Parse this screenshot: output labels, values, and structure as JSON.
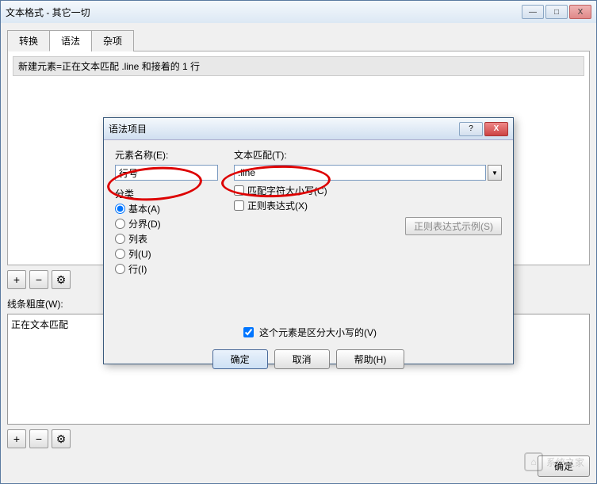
{
  "window": {
    "title": "文本格式 - 其它一切",
    "minimize": "—",
    "maximize": "□",
    "close": "X"
  },
  "tabs": {
    "convert": "转换",
    "syntax": "语法",
    "misc": "杂项"
  },
  "info_text": "新建元素=正在文本匹配 .line 和接着的 1 行",
  "toolbar": {
    "plus": "+",
    "minus": "−",
    "gear": "⚙"
  },
  "thickness_label": "线条粗度(W):",
  "listbox_item": "正在文本匹配",
  "main_buttons": {
    "ok": "确定"
  },
  "dialog": {
    "title": "语法项目",
    "help_q": "?",
    "close": "X",
    "element_name_label": "元素名称(E):",
    "element_name_value": "行号",
    "text_match_label": "文本匹配(T):",
    "text_match_value": ".line",
    "category_label": "分类",
    "radios": {
      "basic": "基本(A)",
      "sep": "分界(D)",
      "list": "列表",
      "col": "列(U)",
      "row": "行(I)"
    },
    "checks": {
      "matchcase": "匹配字符大小写(C)",
      "regex": "正则表达式(X)"
    },
    "example_btn": "正则表达式示例(S)",
    "case_sensitive": "这个元素是区分大小写的(V)",
    "ok": "确定",
    "cancel": "取消",
    "help": "帮助(H)"
  },
  "watermark": "系统之家"
}
